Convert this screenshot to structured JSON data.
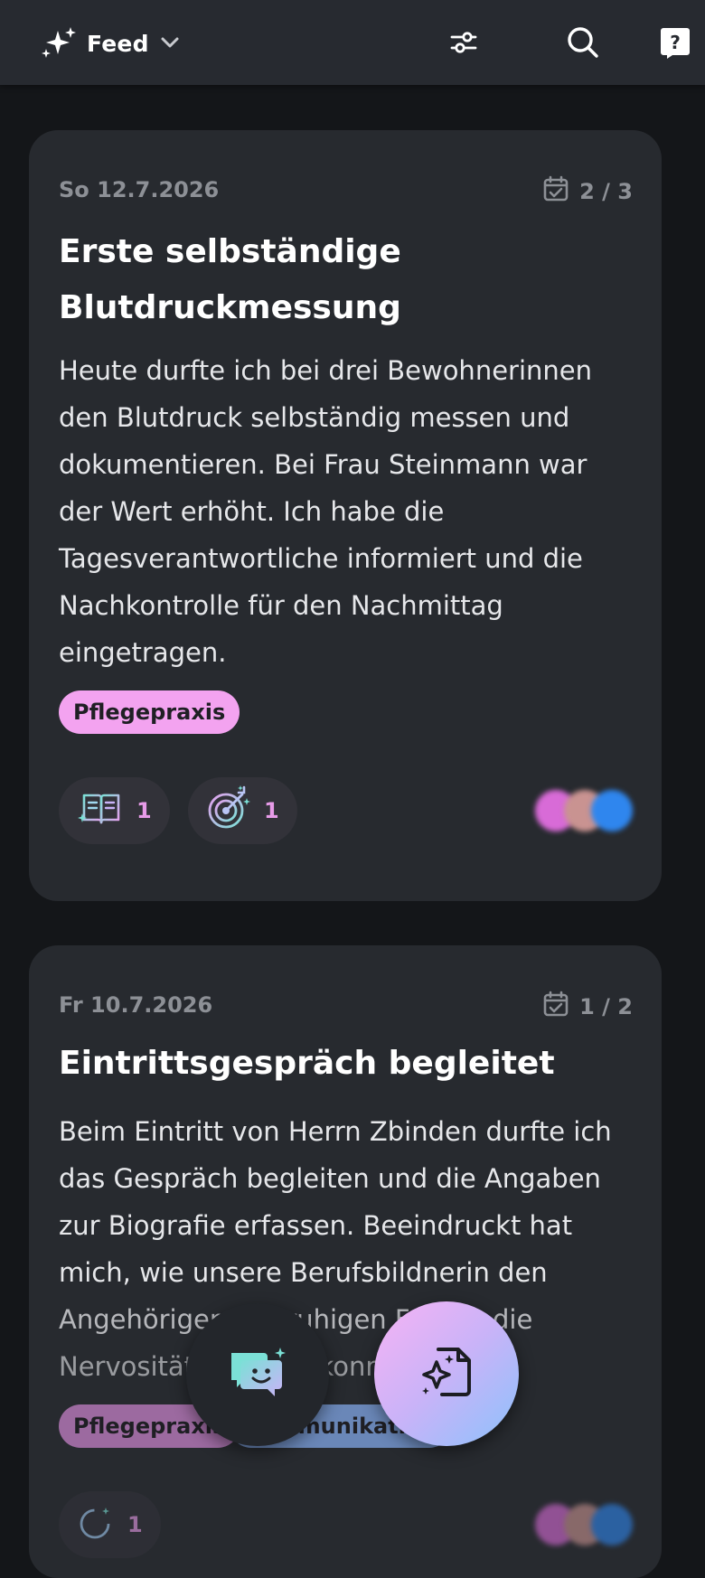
{
  "header": {
    "feed_label": "Feed",
    "icons": [
      "sparkles-icon",
      "chevron-down-icon",
      "filter-sliders-icon",
      "search-icon",
      "help-icon"
    ]
  },
  "entries": [
    {
      "date": "So 12.7.2026",
      "progress": "2 / 3",
      "title": "Erste selbständige Blutdruckmessung",
      "body": "Heute durfte ich bei drei Bewohnerinnen den Blutdruck selbständig messen und dokumentieren. Bei Frau Steinmann war der Wert erhöht. Ich habe die Tagesverantwortliche informiert und die Nachkontrolle für den Nachmittag eingetragen.",
      "tags": [
        "Pflegepraxis"
      ],
      "stats": [
        {
          "icon": "reflection-book-icon",
          "count": "1"
        },
        {
          "icon": "target-goal-icon",
          "count": "1"
        }
      ]
    },
    {
      "date": "Fr 10.7.2026",
      "progress": "1 / 2",
      "title": "Eintrittsgespräch begleitet",
      "body_lines": [
        "Beim Eintritt von Herrn Zbinden durfte ich",
        "das Gespräch begleiten und die Angaben",
        "zur Biografie erfassen. Beeindruckt hat",
        "mich, wie unsere Berufsbildnerin den",
        "Angehörigen mit ruhigen Fragen die",
        "Nervosität nehmen konnte."
      ],
      "tags": [
        "Pflegepraxis",
        "Kommunikation"
      ],
      "stats": [
        {
          "icon": "goal-progress-icon",
          "count": "1"
        }
      ]
    }
  ],
  "colors": {
    "background": "#141619",
    "card": "#272a2f",
    "topbar": "#272a30",
    "tag_pink": "#f3a3f0",
    "tag_blue": "#8fb6f0",
    "stat_count": "#e79be8",
    "avatar_colors": [
      "#d86bd7",
      "#c99391",
      "#2f86ee"
    ]
  },
  "fab": {
    "chat_icon": "chat-assistant-icon",
    "new_entry_icon": "new-entry-sparkle-icon"
  }
}
